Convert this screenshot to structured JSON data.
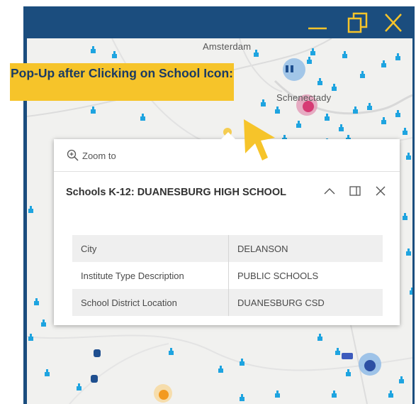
{
  "window": {
    "controls": [
      "minimize-icon",
      "restore-icon",
      "close-icon"
    ],
    "title_bar_color": "#1b4d7e",
    "control_color": "#f6c42a"
  },
  "map": {
    "labels": {
      "amsterdam": "Amsterdam",
      "schenectady": "Schenectady"
    },
    "marker_color": "#1ea4e0"
  },
  "callout": {
    "text": "Pop-Up after Clicking on School Icon:",
    "color": "#f6c42a"
  },
  "popup": {
    "zoom_label": "Zoom to",
    "title": "Schools K-12: DUANESBURG HIGH SCHOOL",
    "actions": [
      "collapse-icon",
      "dock-icon",
      "close-icon"
    ],
    "attributes": [
      {
        "key": "City",
        "value": "DELANSON"
      },
      {
        "key": "Institute Type Description",
        "value": "PUBLIC SCHOOLS"
      },
      {
        "key": "School District Location",
        "value": "DUANESBURG CSD"
      }
    ]
  }
}
